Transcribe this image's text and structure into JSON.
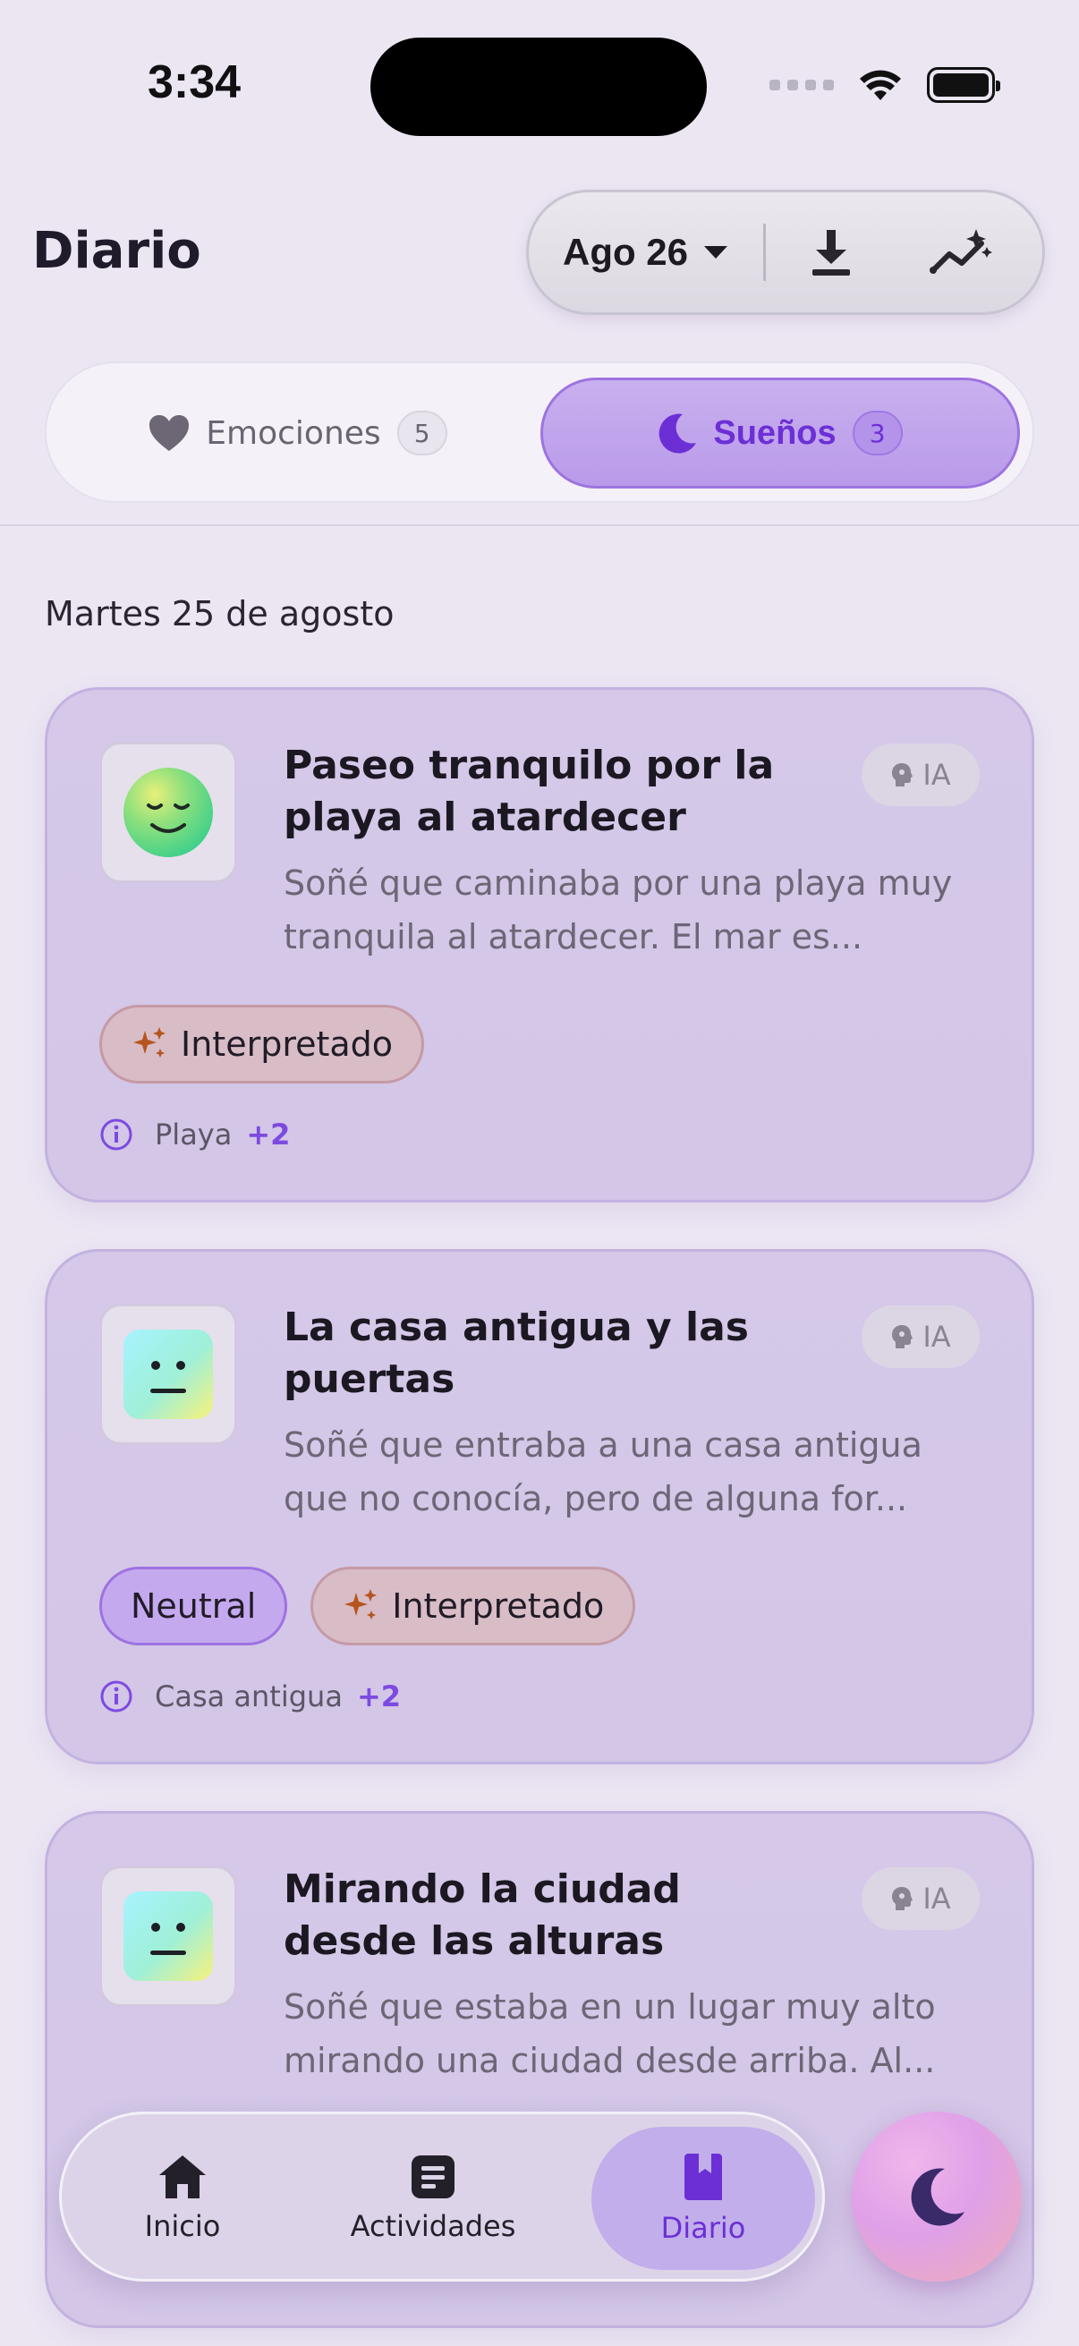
{
  "status_bar": {
    "time": "3:34"
  },
  "header": {
    "title": "Diario",
    "date_label": "Ago 26",
    "download_icon": "download-icon",
    "insights_icon": "sparkle-chart-icon"
  },
  "tabs": [
    {
      "label": "Emociones",
      "count": "5",
      "icon": "heart-icon"
    },
    {
      "label": "Sueños",
      "count": "3",
      "icon": "moon-icon",
      "active": true
    }
  ],
  "day_heading": "Martes 25 de agosto",
  "entries": [
    {
      "title": "Paseo tranquilo por la playa al atardecer",
      "excerpt": "Soñé que caminaba por una playa muy tranquila al atardecer. El mar es...",
      "badge": "IA",
      "tags": [
        "Interpretado"
      ],
      "meta_label": "Playa",
      "meta_more": "+2",
      "face": "calm-face-icon"
    },
    {
      "title": "La casa antigua y las puertas",
      "excerpt": "Soñé que entraba a una casa antigua que no conocía, pero de alguna for...",
      "badge": "IA",
      "tags": [
        "Neutral",
        "Interpretado"
      ],
      "meta_label": "Casa antigua",
      "meta_more": "+2",
      "face": "neutral-face-icon"
    },
    {
      "title": "Mirando la ciudad desde las alturas",
      "excerpt": "Soñé que estaba en un lugar muy alto mirando una ciudad desde arriba. Al...",
      "badge": "IA",
      "face": "neutral-face-icon"
    }
  ],
  "nav": [
    {
      "label": "Inicio",
      "icon": "home-icon"
    },
    {
      "label": "Actividades",
      "icon": "activities-icon"
    },
    {
      "label": "Diario",
      "icon": "bookmark-book-icon",
      "active": true
    }
  ],
  "colors": {
    "accent": "#6c2fd6",
    "interpreted_sparkle": "#b6541f"
  }
}
